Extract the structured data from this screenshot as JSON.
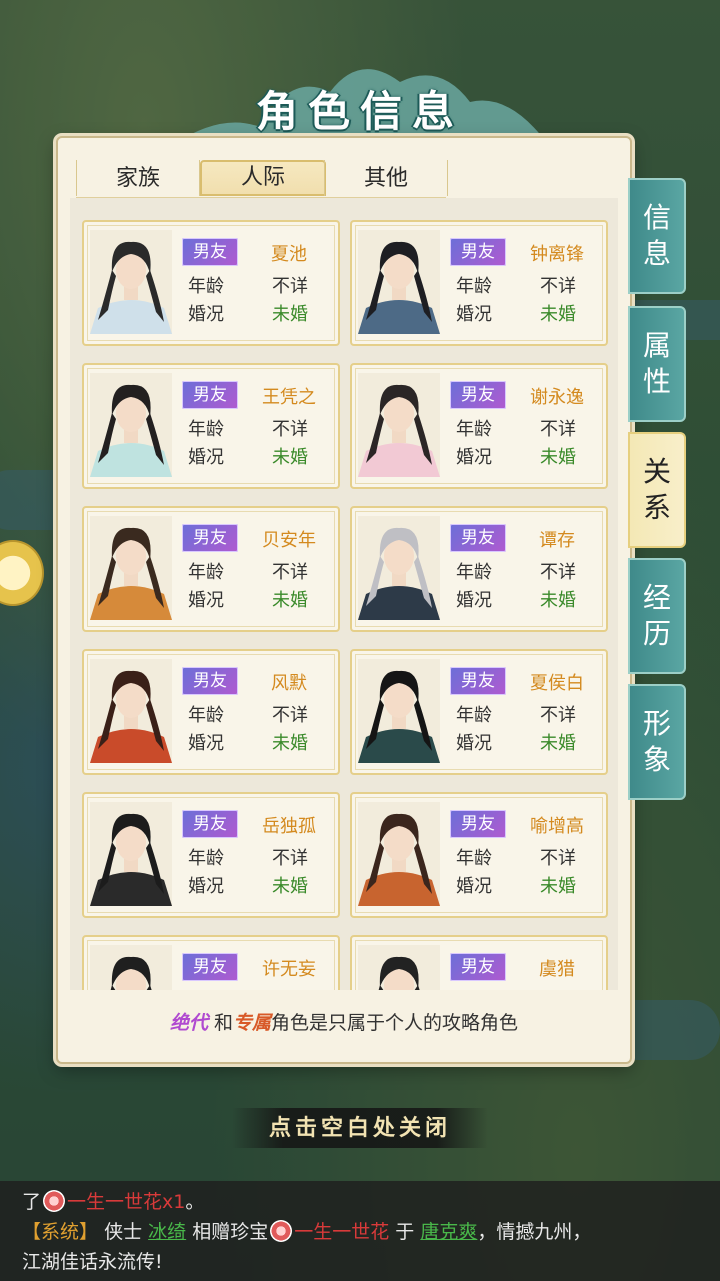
{
  "title": "角色信息",
  "tabs": [
    {
      "label": "家族",
      "active": false
    },
    {
      "label": "人际",
      "active": true
    },
    {
      "label": "其他",
      "active": false
    }
  ],
  "side_tabs": [
    {
      "label": "信息",
      "active": false
    },
    {
      "label": "属性",
      "active": false
    },
    {
      "label": "关系",
      "active": true
    },
    {
      "label": "经历",
      "active": false
    },
    {
      "label": "形象",
      "active": false
    }
  ],
  "field_labels": {
    "age": "年龄",
    "marriage": "婚况"
  },
  "characters": [
    {
      "relation": "男友",
      "name": "夏池",
      "age": "不详",
      "marriage": "未婚"
    },
    {
      "relation": "男友",
      "name": "钟离锋",
      "age": "不详",
      "marriage": "未婚"
    },
    {
      "relation": "男友",
      "name": "王凭之",
      "age": "不详",
      "marriage": "未婚"
    },
    {
      "relation": "男友",
      "name": "谢永逸",
      "age": "不详",
      "marriage": "未婚"
    },
    {
      "relation": "男友",
      "name": "贝安年",
      "age": "不详",
      "marriage": "未婚"
    },
    {
      "relation": "男友",
      "name": "谭存",
      "age": "不详",
      "marriage": "未婚"
    },
    {
      "relation": "男友",
      "name": "风默",
      "age": "不详",
      "marriage": "未婚"
    },
    {
      "relation": "男友",
      "name": "夏侯白",
      "age": "不详",
      "marriage": "未婚"
    },
    {
      "relation": "男友",
      "name": "岳独孤",
      "age": "不详",
      "marriage": "未婚"
    },
    {
      "relation": "男友",
      "name": "喻增高",
      "age": "不详",
      "marriage": "未婚"
    },
    {
      "relation": "男友",
      "name": "许无妄",
      "age": "",
      "marriage": ""
    },
    {
      "relation": "男友",
      "name": "虞猎",
      "age": "",
      "marriage": ""
    }
  ],
  "footer": {
    "tag1": "绝代",
    "and": "和",
    "tag2": "专属",
    "rest": "角色是只属于个人的攻略角色"
  },
  "close_hint": "点击空白处关闭",
  "chat": {
    "line1_prefix": "了",
    "line1_item": "一生一世花x1",
    "line1_end": "。",
    "sys_tag": "【系统】",
    "line2_a": "侠士",
    "player1": "冰绮",
    "line2_b": "相赠珍宝",
    "item": "一生一世花",
    "line2_c": "于",
    "player2": "唐克爽",
    "line2_d": "，情撼九州，",
    "line3": "江湖佳话永流传!"
  },
  "colors": {
    "name": "#d48a1f",
    "marriage": "#3a8a2a",
    "badge_from": "#6b6fd8",
    "badge_to": "#b05ad0",
    "side_tab": "#4f9b98"
  }
}
